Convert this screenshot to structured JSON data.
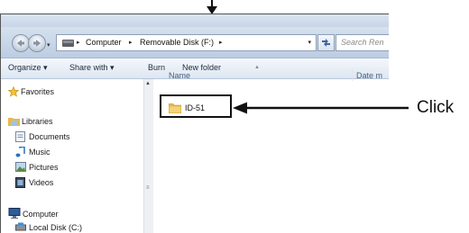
{
  "address": {
    "crumbs": [
      "Computer",
      "Removable Disk (F:)"
    ],
    "search_placeholder": "Search Ren"
  },
  "toolbar": {
    "organize": "Organize ▾",
    "share_with": "Share with ▾",
    "burn": "Burn",
    "new_folder": "New folder"
  },
  "navpane": {
    "favorites": "Favorites",
    "libraries": "Libraries",
    "documents": "Documents",
    "music": "Music",
    "pictures": "Pictures",
    "videos": "Videos",
    "computer": "Computer",
    "local_disk": "Local Disk (C:)"
  },
  "content": {
    "col_name": "Name",
    "col_date": "Date m",
    "files": [
      {
        "name": "ID-51",
        "icon": "folder-icon"
      }
    ]
  },
  "annotation": {
    "callout_label": "Click"
  },
  "colors": {
    "accent": "#3a6ea5",
    "folder": "#e8b84a"
  }
}
